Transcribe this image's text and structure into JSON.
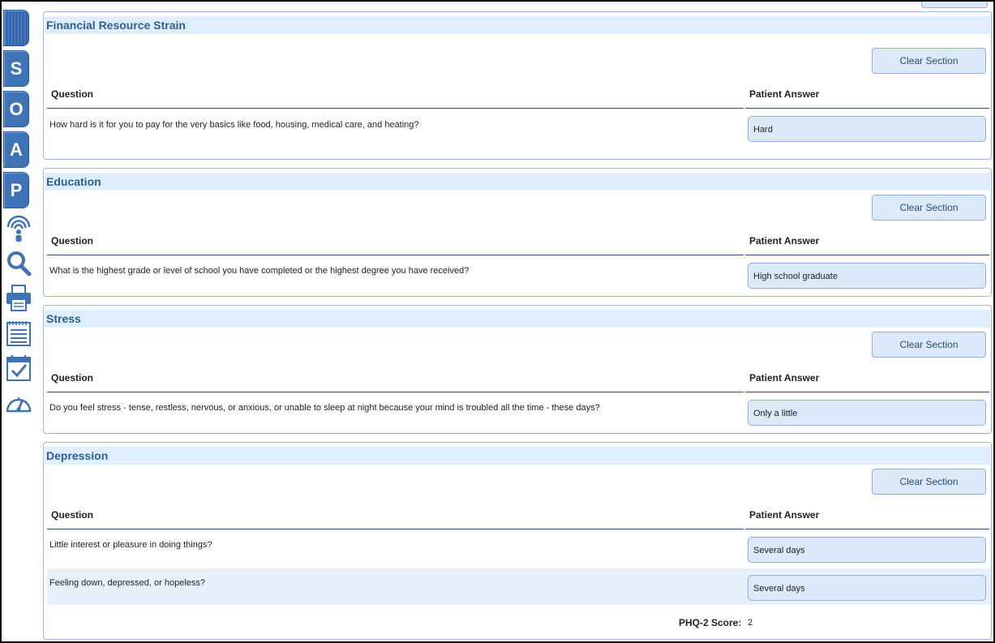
{
  "sidebar": {
    "tabs": [
      {
        "name": "menu-tab",
        "label": ""
      },
      {
        "name": "soap-tab-s",
        "label": "S"
      },
      {
        "name": "soap-tab-o",
        "label": "O"
      },
      {
        "name": "soap-tab-a",
        "label": "A"
      },
      {
        "name": "soap-tab-p",
        "label": "P"
      }
    ],
    "icons": [
      "wireless-person-icon",
      "search-icon",
      "printer-icon",
      "notepad-icon",
      "calendar-check-icon",
      "speedometer-icon"
    ],
    "accent": "#3f73b6"
  },
  "columns": {
    "question": "Question",
    "answer": "Patient Answer"
  },
  "clear_label": "Clear Section",
  "sections": [
    {
      "title": "Financial Resource Strain",
      "rows": [
        {
          "question": "How hard is it for you to pay for the very basics like food, housing, medical care, and heating?",
          "answer": "Hard"
        }
      ]
    },
    {
      "title": "Education",
      "rows": [
        {
          "question": "What is the highest grade or level of school you have completed or the highest degree you have received?",
          "answer": "High school graduate"
        }
      ]
    },
    {
      "title": "Stress",
      "rows": [
        {
          "question": "Do you feel stress - tense, restless, nervous, or anxious, or unable to sleep at night because your mind is troubled all the time - these days?",
          "answer": "Only a little"
        }
      ]
    },
    {
      "title": "Depression",
      "rows": [
        {
          "question": "Little interest or pleasure in doing things?",
          "answer": "Several days"
        },
        {
          "question": "Feeling down, depressed, or hopeless?",
          "answer": "Several days"
        }
      ],
      "score_label": "PHQ-2 Score:",
      "score_value": "2"
    }
  ]
}
